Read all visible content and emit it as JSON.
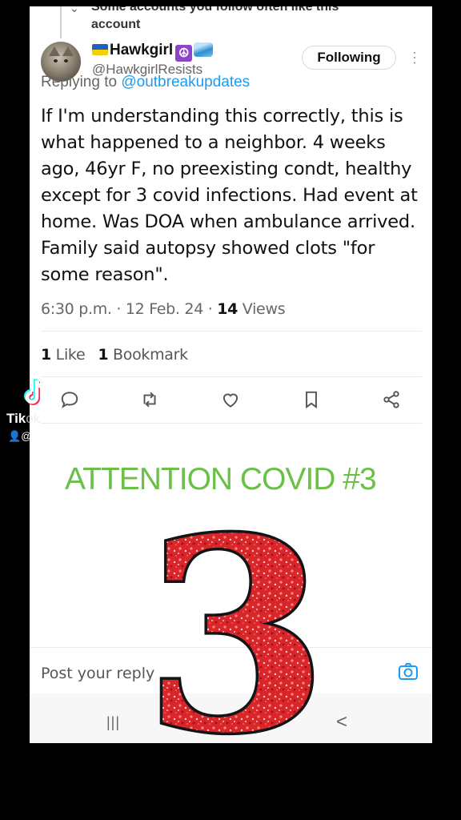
{
  "suggestion": {
    "line1": "Some accounts you follow often like this",
    "line2": "account"
  },
  "post": {
    "display_name": "Hawkgirl",
    "handle": "@HawkgirlResists",
    "replying_prefix": "Replying to ",
    "replying_to": "@outbreakupdates",
    "follow_label": "Following",
    "more_icon": "⋮",
    "text": "If I'm understanding this correctly, this is what happened to a neighbor. 4 weeks ago, 46yr F, no preexisting condt, healthy except for 3 covid infections. Had event at home. Was DOA when ambulance arrived. Family said autopsy showed clots \"for some reason\".",
    "timestamp": "6:30 p.m. · 12 Feb. 24 · ",
    "views_count": "14",
    "views_label": " Views",
    "likes_count": "1",
    "likes_label": " Like",
    "bookmarks_count": "1",
    "bookmarks_label": " Bookmark"
  },
  "actions": [
    "reply-icon",
    "repost-icon",
    "like-icon",
    "bookmark-icon",
    "share-icon"
  ],
  "overlay": {
    "attention_text": "ATTENTION COVID #3",
    "big_number": "3",
    "attention_color": "#6cc04a",
    "glitter_color": "#e0262b"
  },
  "reply_bar": {
    "placeholder": "Post your reply"
  },
  "navbar": {
    "recent_symbol": "|||",
    "back_symbol": "<"
  },
  "tiktok": {
    "brand_visible": "Tik",
    "brand_faint": "ok",
    "user_prefix": "@"
  }
}
